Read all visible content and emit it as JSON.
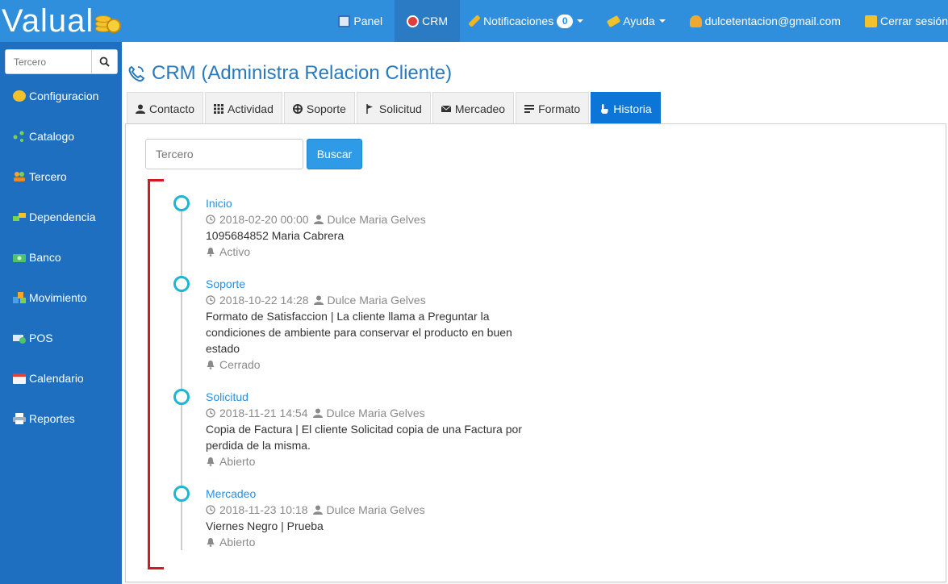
{
  "app": {
    "logo": "Valual",
    "title": "CRM (Administra Relacion Cliente)"
  },
  "topnav": {
    "panel": "Panel",
    "crm": "CRM",
    "notificaciones": "Notificaciones",
    "notif_count": "0",
    "ayuda": "Ayuda",
    "user": "dulcetentacion@gmail.com",
    "logout": "Cerrar sesión"
  },
  "sidebar": {
    "search_placeholder": "Tercero",
    "items": [
      {
        "label": "Configuracion",
        "icon": "gear-icon"
      },
      {
        "label": "Catalogo",
        "icon": "catalog-icon"
      },
      {
        "label": "Tercero",
        "icon": "people-icon"
      },
      {
        "label": "Dependencia",
        "icon": "dependency-icon"
      },
      {
        "label": "Banco",
        "icon": "bank-icon"
      },
      {
        "label": "Movimiento",
        "icon": "movement-icon"
      },
      {
        "label": "POS",
        "icon": "pos-icon"
      },
      {
        "label": "Calendario",
        "icon": "calendar-icon"
      },
      {
        "label": "Reportes",
        "icon": "printer-icon"
      }
    ]
  },
  "tabs": [
    {
      "label": "Contacto",
      "icon": "user-icon"
    },
    {
      "label": "Actividad",
      "icon": "grid-icon"
    },
    {
      "label": "Soporte",
      "icon": "lifebuoy-icon"
    },
    {
      "label": "Solicitud",
      "icon": "flag-icon"
    },
    {
      "label": "Mercadeo",
      "icon": "envelope-icon"
    },
    {
      "label": "Formato",
      "icon": "format-icon"
    },
    {
      "label": "Historia",
      "icon": "hand-icon",
      "active": true
    }
  ],
  "search": {
    "placeholder": "Tercero",
    "button": "Buscar"
  },
  "timeline": [
    {
      "title": "Inicio",
      "datetime": "2018-02-20 00:00",
      "user": "Dulce Maria Gelves",
      "description": "1095684852 Maria Cabrera",
      "status": "Activo"
    },
    {
      "title": "Soporte",
      "datetime": "2018-10-22 14:28",
      "user": "Dulce Maria Gelves",
      "description": "Formato de Satisfaccion | La cliente llama a Preguntar la condiciones de ambiente para conservar el producto en buen estado",
      "status": "Cerrado"
    },
    {
      "title": "Solicitud",
      "datetime": "2018-11-21 14:54",
      "user": "Dulce Maria Gelves",
      "description": "Copia de Factura | El cliente Solicitad copia de una Factura por perdida de la misma.",
      "status": "Abierto"
    },
    {
      "title": "Mercadeo",
      "datetime": "2018-11-23 10:18",
      "user": "Dulce Maria Gelves",
      "description": "Viernes Negro | Prueba",
      "status": "Abierto"
    }
  ],
  "colors": {
    "topbar": "#2f8fdd",
    "sidebar": "#1e6fc0",
    "active_tab": "#0b75d8",
    "timeline_dot": "#1bb6d6",
    "bracket": "#d21a24"
  }
}
